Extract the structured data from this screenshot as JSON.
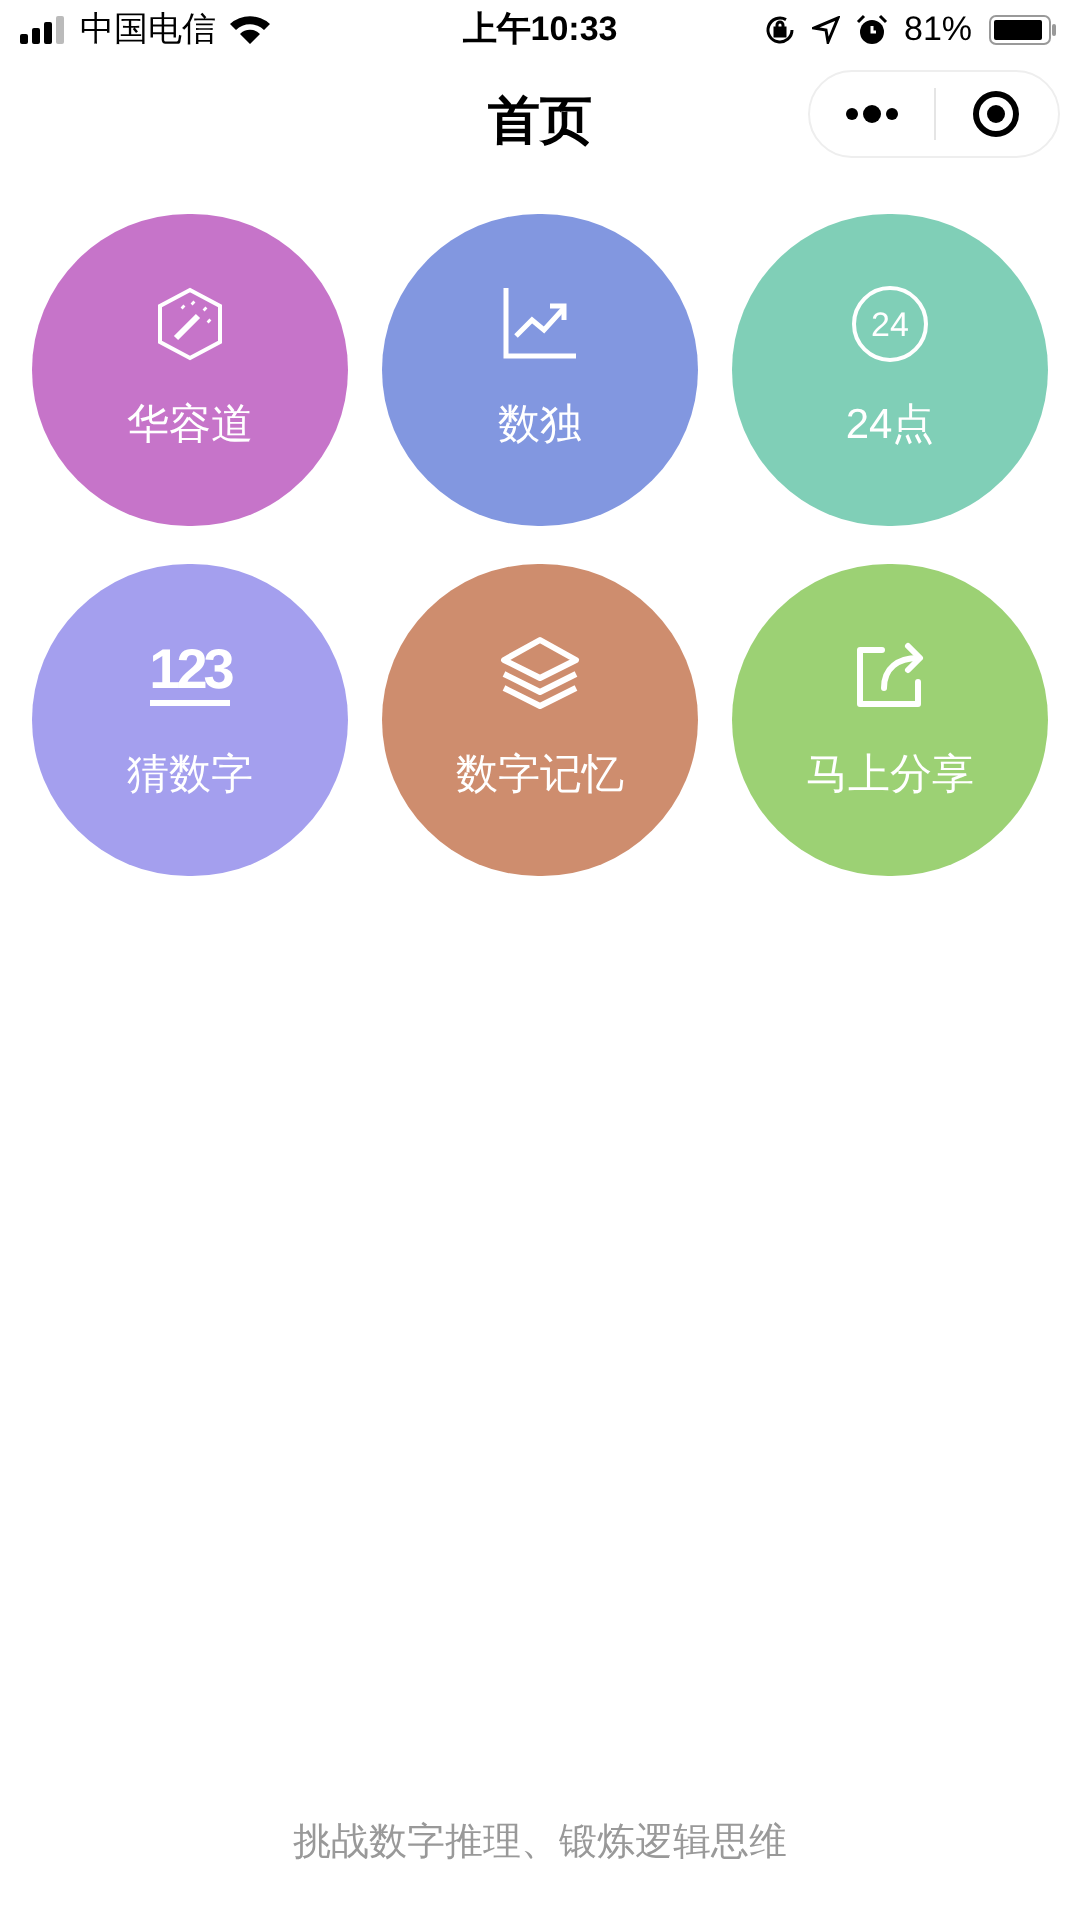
{
  "status_bar": {
    "carrier": "中国电信",
    "time": "上午10:33",
    "battery": "81%"
  },
  "nav": {
    "title": "首页"
  },
  "tiles": [
    {
      "kind": "wand",
      "label": "华容道",
      "color": "#c674c9"
    },
    {
      "kind": "chart",
      "label": "数独",
      "color": "#8297e0"
    },
    {
      "kind": "circle-number",
      "icon_text": "24",
      "label": "24点",
      "color": "#80cfb7"
    },
    {
      "kind": "underline-number",
      "icon_text": "123",
      "label": "猜数字",
      "color": "#a49fee"
    },
    {
      "kind": "layers",
      "label": "数字记忆",
      "color": "#ce8d6e"
    },
    {
      "kind": "share",
      "label": "马上分享",
      "color": "#9cd174"
    }
  ],
  "footer": "挑战数字推理、锻炼逻辑思维"
}
